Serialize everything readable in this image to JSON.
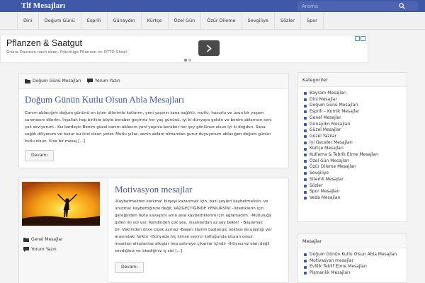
{
  "site": {
    "title": "Tlf Mesajları"
  },
  "search": {
    "placeholder": "Arama"
  },
  "nav": [
    "Dini",
    "Doğum Günü",
    "Esprili",
    "Günaydın",
    "Kürtçe",
    "Özel Gün",
    "Özür Dileme",
    "Sevgiliye",
    "Sözler",
    "Spor"
  ],
  "ad": {
    "title": "Pflanzen & Saatgut",
    "text": "Grüne Daumen nach oben. Prächtige Pflanzen im OTTO-Shop!"
  },
  "post1": {
    "category": "Doğum Günü Mesajları",
    "comments": "Yorum Yazın",
    "title": "Doğum Günün Kutlu Olsun Abla Mesajları",
    "lines": [
      "Canım ablacığım doğum gününü en içten dilerimle kutlarım, yeni yaşının sana sağlıklı, mutlu, huzurlu ve uzun bir yaşam",
      "sunmasını dilerim. İnşallah hep birlikte böyle beraber geçiririz her yaş gününü, iyi ki dünyaya geldin ve benim ablamsın seni",
      "çok seviyorum . Kız kardeşin Benim güzel canım ablacım yeni yaşınla beraber her şey gönlünce olsun iyi ki doğdun. Sana",
      "sağlık diliyorum ve huzur bu ikisi olsun yeter. Mutlu yıllar, senin ablam olmandan gurur duyuyorum ablacığım doğum günün",
      "kutlu olsun. Kısa bir mesaj [...]"
    ],
    "button": "Devamı"
  },
  "post2": {
    "category": "Genel Mesajlar",
    "comments": "Yorum Yazın",
    "title": "Motivasyon mesajlar",
    "lines": [
      "-Kaybetmekten korkma! birşeyi kazanmak için, bazı şeyleri kaybetmelisin. ve",
      "unutma! kaybettiğinde değil; VAZGEÇTİĞİNDE YENİLİRSİN! -İstediklerin için",
      "gereğinden fazla savaştım ama asla kaybettiklerim için ağlamadım. -Mutluluğa",
      "giden iki yol var; Kendinden çok şey, insanlardan az şey bekle! - Başlamak",
      "bil. Vaktinden önce çiçek açmaz -Başarı kişinin başlangıç noktası ile ulaştığı yer",
      "arasındaki farktır -Dünyada hiç kimse seyirci koltuğunda oturan cesur",
      "insanları alkışlamaz alkışlar hep sahneye çıkanlar içindir -İhtiyacınız olan değil",
      "sevdiğiniz ve istediğiniz iş sizi [...]"
    ],
    "button": "Devamı"
  },
  "widget1": {
    "title": "Kategoriler",
    "items": [
      "Bayram Mesajları",
      "Dini Mesajlar",
      "Doğum Günü Mesajları",
      "Esprili – Komik Mesajlar",
      "Genel Mesajlar",
      "Günaydın Mesajları",
      "Güzel Mesajlar",
      "Güzel Yazılar",
      "İyi Geceler Mesajları",
      "Kürtçe Mesajları",
      "Kutlama & Tebrik Etme Mesajları",
      "Özel Gün Mesajları",
      "Özür Dileme Mesajları",
      "Sevgiliye",
      "Sitemli Mesajlar",
      "Sözler",
      "Spor Mesajları",
      "Veda Mesajları"
    ]
  },
  "widget2": {
    "title": "Mesajlar",
    "items": [
      "Doğum Günün Kutlu Olsun Abla Mesajları",
      "Motivasyon mesajlar",
      "Evlilik Teklif Etme Mesajları",
      "Pişmanlık Mesajları"
    ]
  },
  "colors": {
    "brand": "#3f58a8",
    "link": "#3f58a8"
  }
}
